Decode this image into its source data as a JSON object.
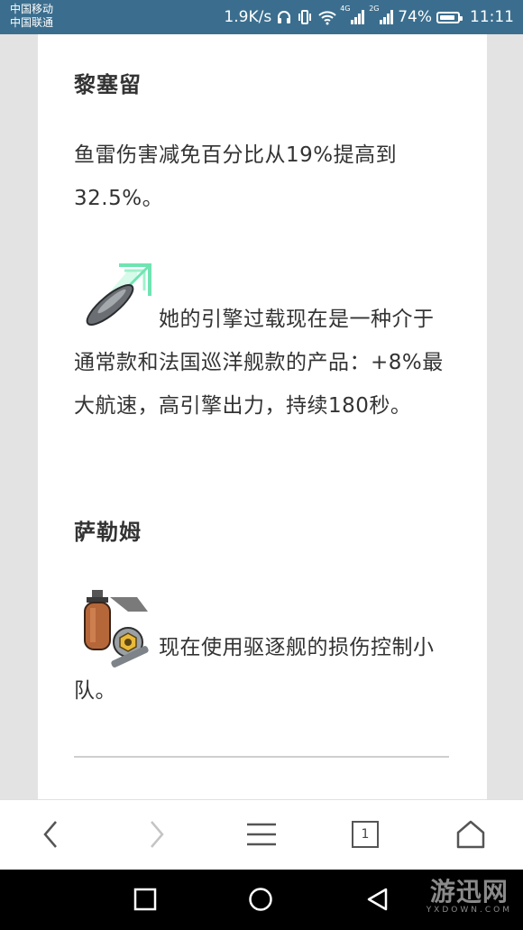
{
  "status_bar": {
    "carrier1": "中国移动",
    "carrier2": "中国联通",
    "net_speed": "1.9K/s",
    "sig1_label": "4G",
    "sig2_label": "2G",
    "battery": "74%",
    "time": "11:11"
  },
  "article": {
    "section1_heading": "黎塞留",
    "section1_text": "鱼雷伤害减免百分比从19%提高到32.5%。",
    "engine_text": "她的引擎过载现在是一种介于通常款和法国巡洋舰款的产品：+8%最大航速，高引擎出力，持续180秒。",
    "section2_heading": "萨勒姆",
    "damage_control_text": "现在使用驱逐舰的损伤控制小队。"
  },
  "browser_bar": {
    "tab_count": "1"
  },
  "watermark": {
    "main": "游迅网",
    "sub": "YXDOWN.COM"
  },
  "colors": {
    "status_bar_bg": "#3b6e8e",
    "page_bg": "#e3e3e3",
    "text": "#333333"
  },
  "icons": [
    "engine-boost-icon",
    "damage-control-icon",
    "back-icon",
    "forward-icon",
    "menu-icon",
    "tabs-icon",
    "home-icon"
  ]
}
